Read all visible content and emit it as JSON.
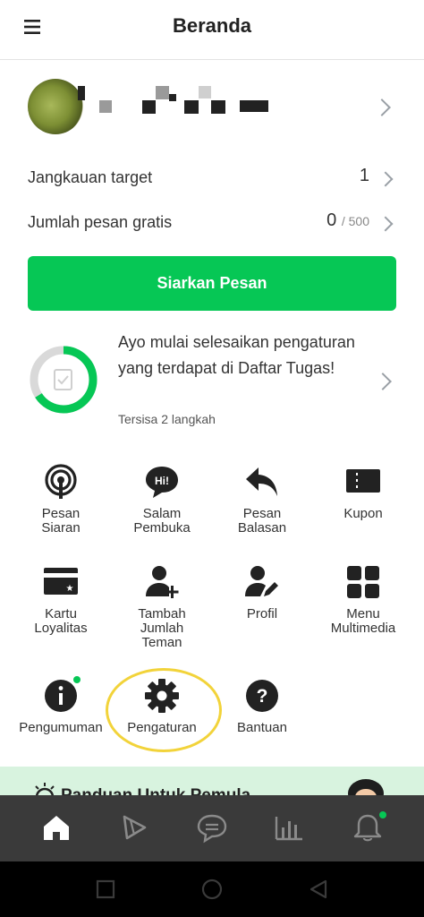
{
  "header": {
    "title": "Beranda",
    "menu_icon": "hamburger-menu-icon"
  },
  "profile": {
    "avatar": "matcha-avatar-image",
    "chevron_icon": "chevron-right-icon"
  },
  "stats": [
    {
      "label": "Jangkauan target",
      "value": "1",
      "suffix": ""
    },
    {
      "label": "Jumlah pesan gratis",
      "value": "0",
      "suffix": "/ 500"
    }
  ],
  "broadcast_button": {
    "label": "Siarkan Pesan",
    "color": "#06c755"
  },
  "task_card": {
    "text": "Ayo mulai selesaikan pengaturan yang terdapat di Daftar Tugas!",
    "remaining": "Tersisa 2 langkah",
    "progress": 0.66
  },
  "menu_grid": [
    {
      "label1": "Pesan",
      "label2": "Siaran",
      "label3": "",
      "icon": "broadcast-icon"
    },
    {
      "label1": "Salam",
      "label2": "Pembuka",
      "label3": "",
      "icon": "greeting-icon"
    },
    {
      "label1": "Pesan",
      "label2": "Balasan",
      "label3": "",
      "icon": "reply-icon"
    },
    {
      "label1": "Kupon",
      "label2": "",
      "label3": "",
      "icon": "coupon-icon"
    },
    {
      "label1": "Kartu",
      "label2": "Loyalitas",
      "label3": "",
      "icon": "loyalty-card-icon"
    },
    {
      "label1": "Tambah",
      "label2": "Jumlah",
      "label3": "Teman",
      "icon": "add-friend-icon"
    },
    {
      "label1": "Profil",
      "label2": "",
      "label3": "",
      "icon": "profile-edit-icon"
    },
    {
      "label1": "Menu",
      "label2": "Multimedia",
      "label3": "",
      "icon": "multimedia-menu-icon"
    },
    {
      "label1": "Pengumuman",
      "label2": "",
      "label3": "",
      "icon": "announcement-icon"
    },
    {
      "label1": "Pengaturan",
      "label2": "",
      "label3": "",
      "icon": "gear-icon"
    },
    {
      "label1": "Bantuan",
      "label2": "",
      "label3": "",
      "icon": "help-icon"
    }
  ],
  "banner": {
    "text": "Panduan Untuk Pemula"
  },
  "bottom_nav": [
    "home-icon",
    "voom-icon",
    "chat-icon",
    "insight-chart-icon",
    "notification-bell-icon"
  ],
  "system_nav": [
    "recent-apps-icon",
    "home-circle-icon",
    "back-triangle-icon"
  ]
}
